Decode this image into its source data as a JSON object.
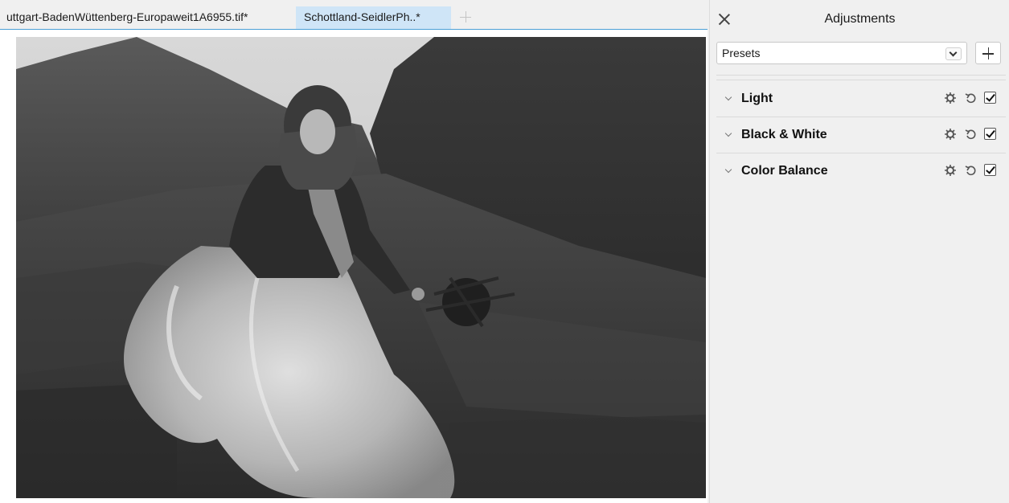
{
  "tabs": [
    {
      "label": "uttgart-BadenWüttenberg-Europaweit1A6955.tif*",
      "active": false
    },
    {
      "label": "Schottland-SeidlerPh..*",
      "active": true
    }
  ],
  "image": {
    "description_icon": "photo-canvas"
  },
  "panel": {
    "title": "Adjustments",
    "presets_value": "Presets",
    "adjustments": [
      {
        "label": "Light",
        "enabled": true
      },
      {
        "label": "Black & White",
        "enabled": true
      },
      {
        "label": "Color Balance",
        "enabled": true
      }
    ]
  },
  "colors": {
    "accent": "#4a9fd6",
    "active_tab": "#cfe5f7",
    "panel_bg": "#f0f0f0"
  }
}
